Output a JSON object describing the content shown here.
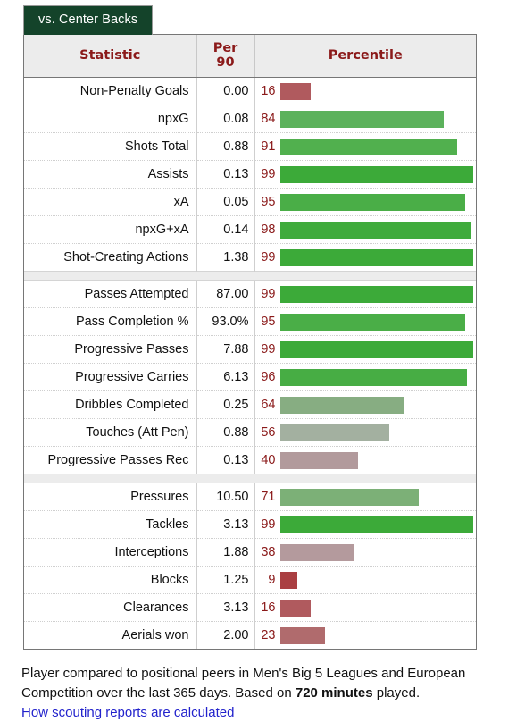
{
  "tab": {
    "label": "vs. Center Backs"
  },
  "table": {
    "headers": {
      "statistic": "Statistic",
      "per90": "Per 90",
      "percentile": "Percentile"
    },
    "groups": [
      {
        "rows": [
          {
            "statistic": "Non-Penalty Goals",
            "per90": "0.00",
            "percentile": 16,
            "color": "#b05a5e"
          },
          {
            "statistic": "npxG",
            "per90": "0.08",
            "percentile": 84,
            "color": "#5cb25c"
          },
          {
            "statistic": "Shots Total",
            "per90": "0.88",
            "percentile": 91,
            "color": "#51b04e"
          },
          {
            "statistic": "Assists",
            "per90": "0.13",
            "percentile": 99,
            "color": "#3caa39"
          },
          {
            "statistic": "xA",
            "per90": "0.05",
            "percentile": 95,
            "color": "#4aae47"
          },
          {
            "statistic": "npxG+xA",
            "per90": "0.14",
            "percentile": 98,
            "color": "#3fab3c"
          },
          {
            "statistic": "Shot-Creating Actions",
            "per90": "1.38",
            "percentile": 99,
            "color": "#3caa39"
          }
        ]
      },
      {
        "rows": [
          {
            "statistic": "Passes Attempted",
            "per90": "87.00",
            "percentile": 99,
            "color": "#3caa39"
          },
          {
            "statistic": "Pass Completion %",
            "per90": "93.0%",
            "percentile": 95,
            "color": "#4aae47"
          },
          {
            "statistic": "Progressive Passes",
            "per90": "7.88",
            "percentile": 99,
            "color": "#3caa39"
          },
          {
            "statistic": "Progressive Carries",
            "per90": "6.13",
            "percentile": 96,
            "color": "#47ad44"
          },
          {
            "statistic": "Dribbles Completed",
            "per90": "0.25",
            "percentile": 64,
            "color": "#87ad82"
          },
          {
            "statistic": "Touches (Att Pen)",
            "per90": "0.88",
            "percentile": 56,
            "color": "#a3b0a0"
          },
          {
            "statistic": "Progressive Passes Rec",
            "per90": "0.13",
            "percentile": 40,
            "color": "#b29a9c"
          }
        ]
      },
      {
        "rows": [
          {
            "statistic": "Pressures",
            "per90": "10.50",
            "percentile": 71,
            "color": "#7cb077"
          },
          {
            "statistic": "Tackles",
            "per90": "3.13",
            "percentile": 99,
            "color": "#3caa39"
          },
          {
            "statistic": "Interceptions",
            "per90": "1.88",
            "percentile": 38,
            "color": "#b49a9d"
          },
          {
            "statistic": "Blocks",
            "per90": "1.25",
            "percentile": 9,
            "color": "#aa3f42"
          },
          {
            "statistic": "Clearances",
            "per90": "3.13",
            "percentile": 16,
            "color": "#b05a5e"
          },
          {
            "statistic": "Aerials won",
            "per90": "2.00",
            "percentile": 23,
            "color": "#b06b6d"
          }
        ]
      }
    ]
  },
  "footer": {
    "line1": "Player compared to positional peers in Men's Big 5 Leagues and European",
    "line2_pre": "Competition over the last 365 days. Based on ",
    "line2_bold": "720 minutes",
    "line2_post": " played.",
    "link": "How scouting reports are calculated"
  }
}
